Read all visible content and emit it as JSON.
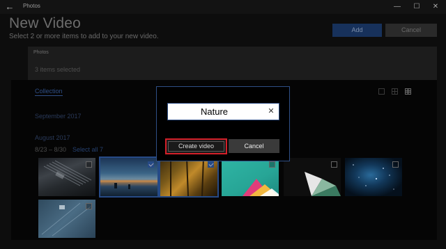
{
  "window": {
    "back_glyph": "←",
    "title": "Photos",
    "minimize_glyph": "—",
    "maximize_glyph": "☐",
    "close_glyph": "✕"
  },
  "header": {
    "title": "New Video",
    "subtitle": "Select 2 or more items to add to your new video.",
    "add_label": "Add",
    "cancel_label": "Cancel"
  },
  "selection_bar": {
    "label": "Photos",
    "count": "3 items selected"
  },
  "collection": {
    "tab_label": "Collection",
    "month_1": "September 2017",
    "month_2": "August 2017",
    "date_range": "8/23 – 8/30",
    "select_all": "Select all 7",
    "photos": [
      {
        "name": "circuit-board",
        "selected": false
      },
      {
        "name": "lake-sunrise",
        "selected": true
      },
      {
        "name": "autumn-forest",
        "selected": true
      },
      {
        "name": "teal-paper-abstract",
        "selected": false
      },
      {
        "name": "dark-fan-abstract",
        "selected": false
      },
      {
        "name": "starfield-nebula",
        "selected": false
      },
      {
        "name": "blue-panel-abstract",
        "selected": false
      }
    ]
  },
  "dialog": {
    "name_value": "Nature",
    "clear_glyph": "✕",
    "create_label": "Create video",
    "cancel_label": "Cancel"
  },
  "colors": {
    "accent": "#2f4f86",
    "highlight": "#d42029",
    "background": "#0d0d0d"
  }
}
